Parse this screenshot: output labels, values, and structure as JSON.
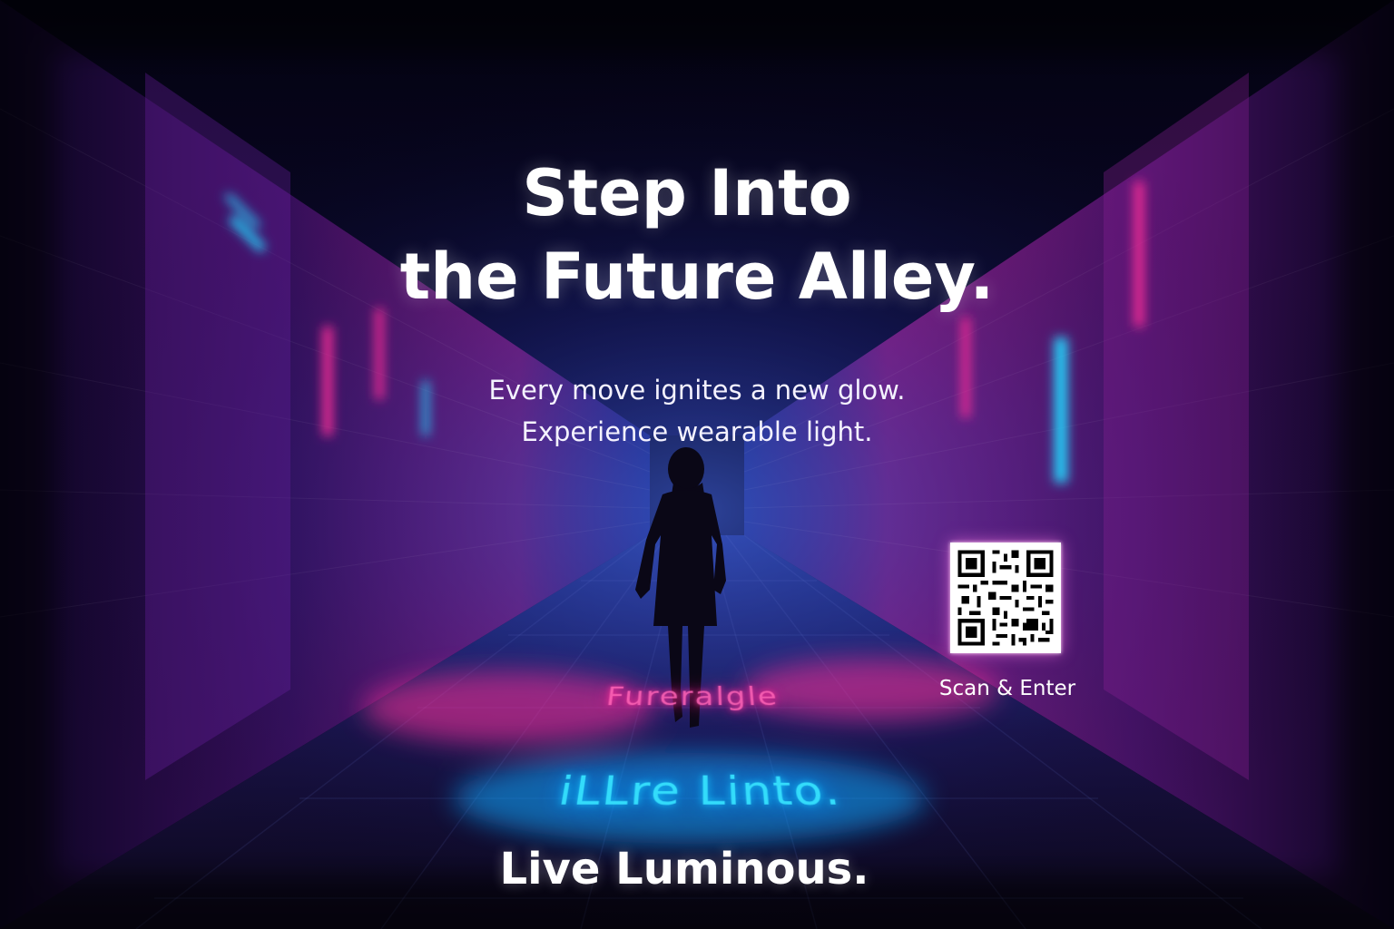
{
  "headline": {
    "line1": "Step Into",
    "line2": "the Future Alley."
  },
  "subheadline": {
    "line1": "Every move ignites a new glow.",
    "line2": "Experience wearable light."
  },
  "floor_text": {
    "pink": "Fureralgle",
    "cyan": "iLLre Linto."
  },
  "tagline": "Live Luminous.",
  "qr": {
    "label": "Scan & Enter",
    "icon": "qr-code-icon"
  },
  "colors": {
    "neon_pink": "#ff2f9a",
    "neon_cyan": "#12c9ff",
    "deep_blue": "#1b1f6b",
    "text": "#ffffff"
  }
}
